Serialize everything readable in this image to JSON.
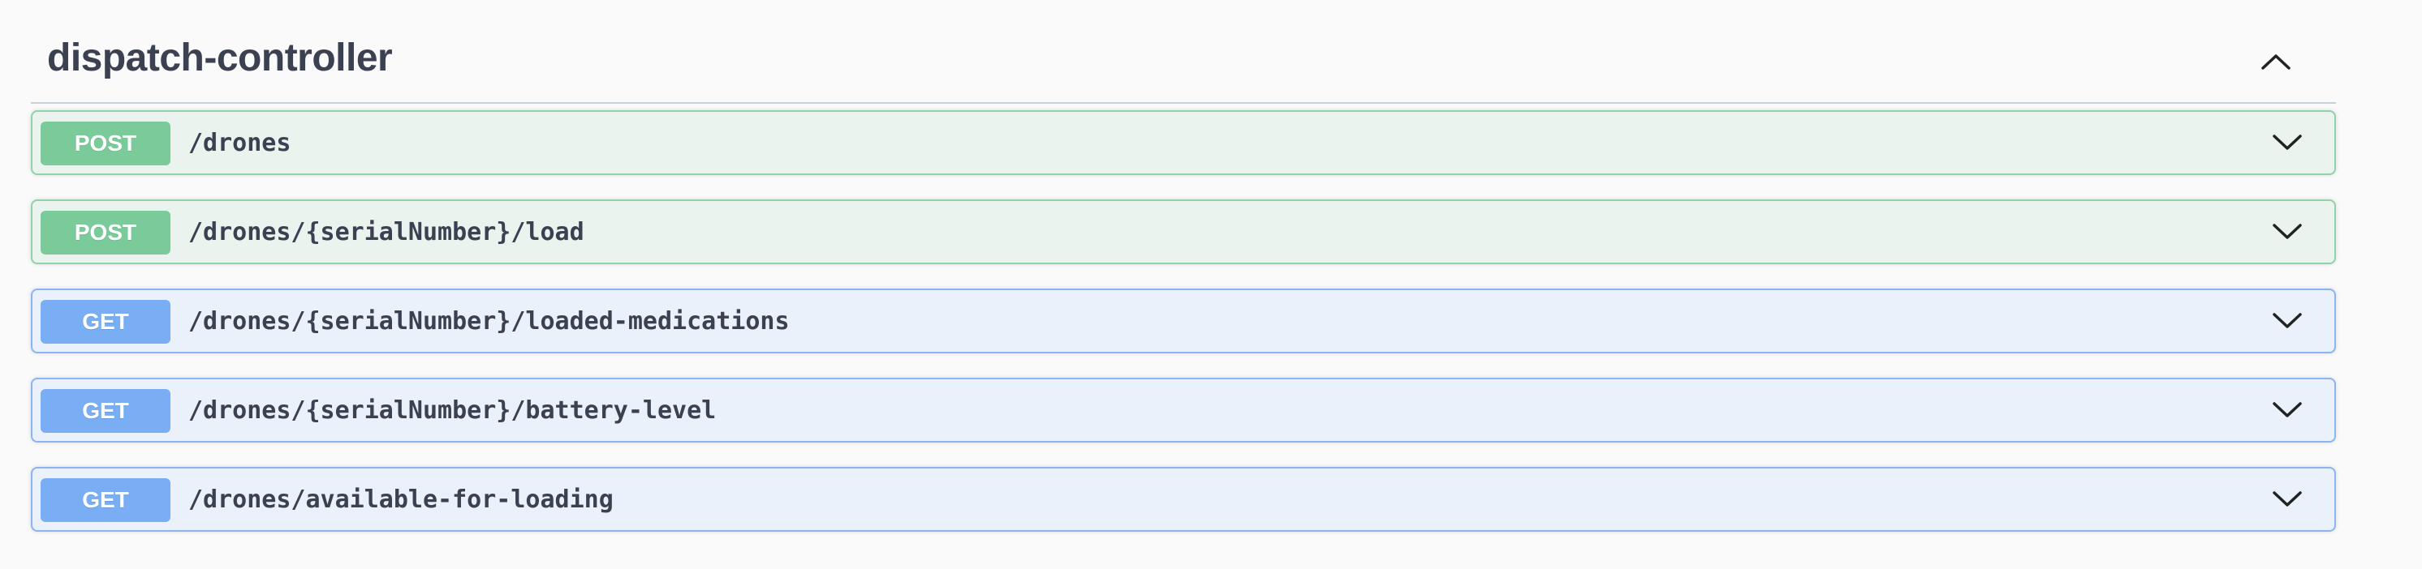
{
  "section": {
    "title": "dispatch-controller",
    "toggle_icon": "chevron-up-icon"
  },
  "colors": {
    "post_badge": "#7acb99",
    "post_background": "#ebf3ef",
    "post_border": "#8fd3a9",
    "get_badge": "#79aef5",
    "get_background": "#ebf1fa",
    "get_border": "#8ab4f2",
    "text": "#3b4151"
  },
  "operations": [
    {
      "method": "POST",
      "path": "/drones",
      "expand_icon": "chevron-down-icon"
    },
    {
      "method": "POST",
      "path": "/drones/{serialNumber}/load",
      "expand_icon": "chevron-down-icon"
    },
    {
      "method": "GET",
      "path": "/drones/{serialNumber}/loaded-medications",
      "expand_icon": "chevron-down-icon"
    },
    {
      "method": "GET",
      "path": "/drones/{serialNumber}/battery-level",
      "expand_icon": "chevron-down-icon"
    },
    {
      "method": "GET",
      "path": "/drones/available-for-loading",
      "expand_icon": "chevron-down-icon"
    }
  ]
}
